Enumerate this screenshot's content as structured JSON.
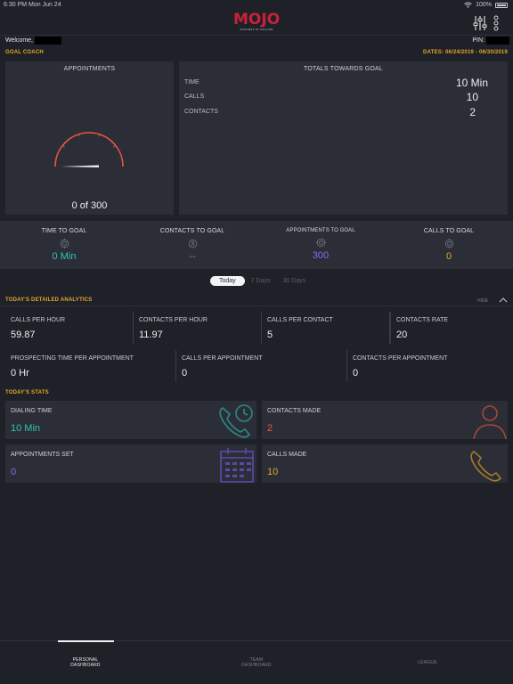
{
  "status_bar": {
    "time": "6:30 PM   Mon Jun 24",
    "battery": "100%"
  },
  "header": {
    "logo_main": "MOJO",
    "logo_tagline": "SUCCESS IN CALLING"
  },
  "welcome": {
    "label": "Welcome,",
    "pin_label": "PIN:"
  },
  "goal_coach": {
    "title": "GOAL COACH",
    "dates": "DATES: 06/24/2019 - 06/30/2019"
  },
  "appointments_card": {
    "title": "APPOINTMENTS",
    "progress_text": "0 of 300",
    "progress_value": 0,
    "progress_max": 300
  },
  "totals_card": {
    "title": "TOTALS TOWARDS GOAL",
    "rows": [
      {
        "label": "TIME",
        "value": "10 Min"
      },
      {
        "label": "CALLS",
        "value": "10"
      },
      {
        "label": "CONTACTS",
        "value": "2"
      }
    ]
  },
  "goals": [
    {
      "label": "TIME TO GOAL",
      "value": "0 Min",
      "color": "#2ec4b6"
    },
    {
      "label": "CONTACTS TO GOAL",
      "value": "--",
      "color": "#e8573f"
    },
    {
      "label": "APPOINTMENTS TO GOAL",
      "value": "300",
      "color": "#7b6cf6"
    },
    {
      "label": "CALLS TO GOAL",
      "value": "0",
      "color": "#e3a52b"
    }
  ],
  "range_tabs": [
    "Today",
    "7 Days",
    "30 Days"
  ],
  "analytics": {
    "title": "TODAY'S DETAILED ANALYTICS",
    "hide_label": "HIDE",
    "row1": [
      {
        "label": "CALLS PER HOUR",
        "value": "59.87"
      },
      {
        "label": "CONTACTS PER HOUR",
        "value": "11.97"
      },
      {
        "label": "CALLS PER CONTACT",
        "value": "5"
      },
      {
        "label": "CONTACTS RATE",
        "value": "20"
      }
    ],
    "row2": [
      {
        "label": "PROSPECTING TIME PER APPOINTMENT",
        "value": "0 Hr"
      },
      {
        "label": "CALLS PER APPOINTMENT",
        "value": "0"
      },
      {
        "label": "CONTACTS PER APPOINTMENT",
        "value": "0"
      }
    ]
  },
  "stats": {
    "title": "TODAY'S STATS",
    "items": [
      {
        "label": "DIALING TIME",
        "value": "10 Min",
        "color": "#2ec4b6",
        "icon": "phone-clock-icon"
      },
      {
        "label": "CONTACTS MADE",
        "value": "2",
        "color": "#e8573f",
        "icon": "person-icon"
      },
      {
        "label": "APPOINTMENTS SET",
        "value": "0",
        "color": "#7b6cf6",
        "icon": "calendar-icon"
      },
      {
        "label": "CALLS MADE",
        "value": "10",
        "color": "#e3a52b",
        "icon": "phone-icon"
      }
    ]
  },
  "tabbar": {
    "personal": [
      "PERSONAL",
      "DASHBOARD"
    ],
    "team": [
      "TEAM",
      "DASHBOARD"
    ],
    "league": "LEAGUE"
  },
  "colors": {
    "background": "#1f2128",
    "card": "#2c2e37",
    "gauge": "#e8573f",
    "gold": "#e3a52b"
  }
}
